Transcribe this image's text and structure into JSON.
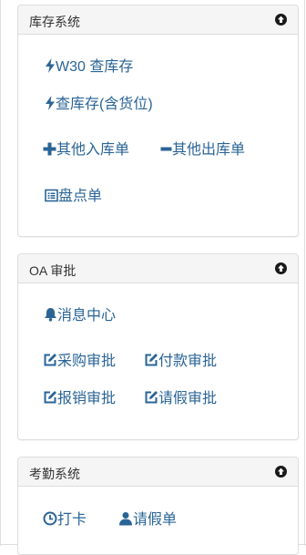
{
  "panels": [
    {
      "title": "库存系统",
      "links": [
        {
          "label": "W30 查库存",
          "icon": "bolt-icon"
        },
        {
          "label": "查库存(含货位)",
          "icon": "bolt-icon"
        },
        {
          "label": "其他入库单",
          "icon": "plus-icon"
        },
        {
          "label": "其他出库单",
          "icon": "minus-icon"
        },
        {
          "label": "盘点单",
          "icon": "list-alt-icon"
        }
      ]
    },
    {
      "title": "OA 审批",
      "links": [
        {
          "label": "消息中心",
          "icon": "bell-icon"
        },
        {
          "label": "采购审批",
          "icon": "edit-icon"
        },
        {
          "label": "付款审批",
          "icon": "edit-icon"
        },
        {
          "label": "报销审批",
          "icon": "edit-icon"
        },
        {
          "label": "请假审批",
          "icon": "edit-icon"
        }
      ]
    },
    {
      "title": "考勤系统",
      "links": [
        {
          "label": "打卡",
          "icon": "clock-icon"
        },
        {
          "label": "请假单",
          "icon": "user-icon"
        }
      ]
    }
  ],
  "colors": {
    "link": "#2a6496",
    "heading_bg": "#f5f5f5",
    "border": "#dddddd",
    "collapse_icon": "#1a1a1a"
  }
}
